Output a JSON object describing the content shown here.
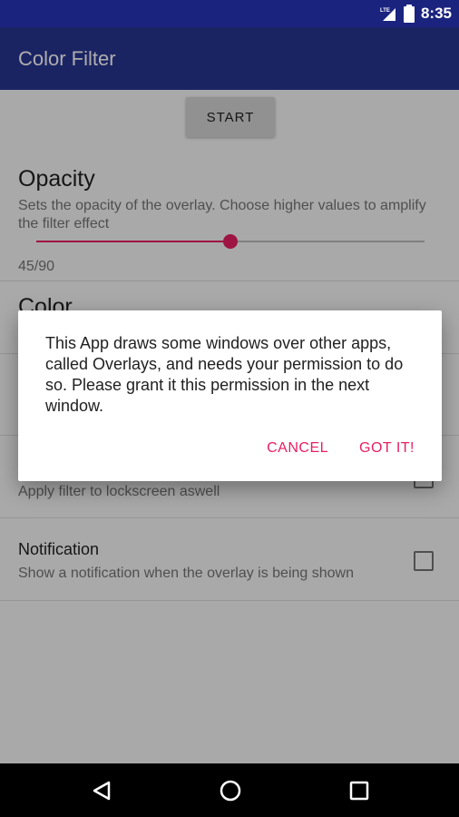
{
  "status_bar": {
    "time": "8:35",
    "network_label": "LTE",
    "icons": [
      "lte-signal-icon",
      "battery-icon"
    ]
  },
  "app_bar": {
    "title": "Color Filter"
  },
  "main": {
    "start_label": "START",
    "opacity": {
      "title": "Opacity",
      "summary": "Sets the opacity of the overlay. Choose higher values to amplify the filter effect",
      "value_text": "45/90",
      "value": 45,
      "max": 90
    },
    "color": {
      "title": "Color"
    },
    "lockscreen": {
      "summary": "Apply filter to lockscreen aswell",
      "checked": false
    },
    "notification": {
      "title": "Notification",
      "summary": "Show a notification when the overlay is being shown",
      "checked": false
    }
  },
  "dialog": {
    "message": "This App draws some windows over other apps, called Overlays, and needs your permission to do so. Please grant it this permission in the next window.",
    "cancel_label": "CANCEL",
    "confirm_label": "GOT IT!"
  },
  "nav_bar": {
    "icons": [
      "back-icon",
      "home-icon",
      "recents-icon"
    ]
  },
  "colors": {
    "primary_dark": "#1a237e",
    "primary": "#283593",
    "accent": "#e91e63"
  }
}
